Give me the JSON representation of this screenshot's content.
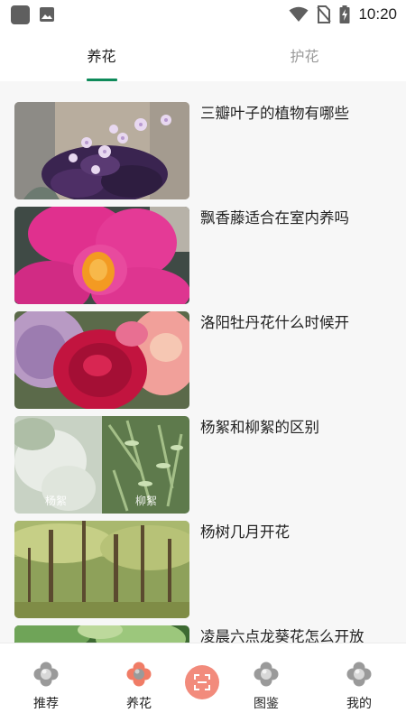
{
  "status_bar": {
    "time": "10:20",
    "icons": [
      "app-icon",
      "image-icon",
      "wifi-icon",
      "no-sim-icon",
      "battery-charging-icon"
    ]
  },
  "tabs": [
    {
      "label": "养花",
      "active": true
    },
    {
      "label": "护花",
      "active": false
    }
  ],
  "articles": [
    {
      "title": "三瓣叶子的植物有哪些"
    },
    {
      "title": "飘香藤适合在室内养吗"
    },
    {
      "title": "洛阳牡丹花什么时候开"
    },
    {
      "title": "杨絮和柳絮的区别",
      "image_captions": [
        "杨絮",
        "柳絮"
      ]
    },
    {
      "title": "杨树几月开花"
    },
    {
      "title": "凌晨六点龙葵花怎么开放"
    }
  ],
  "bottom_nav": {
    "items": [
      {
        "label": "推荐",
        "icon": "clover-icon",
        "active": false
      },
      {
        "label": "养花",
        "icon": "clover-icon",
        "active": true
      },
      {
        "label": "图鉴",
        "icon": "clover-icon",
        "active": false
      },
      {
        "label": "我的",
        "icon": "clover-icon",
        "active": false
      }
    ],
    "scan_icon": "scan-icon"
  },
  "colors": {
    "accent_green": "#0e8a5a",
    "active_nav": "#f08070",
    "scan_button": "#f28b7c"
  }
}
